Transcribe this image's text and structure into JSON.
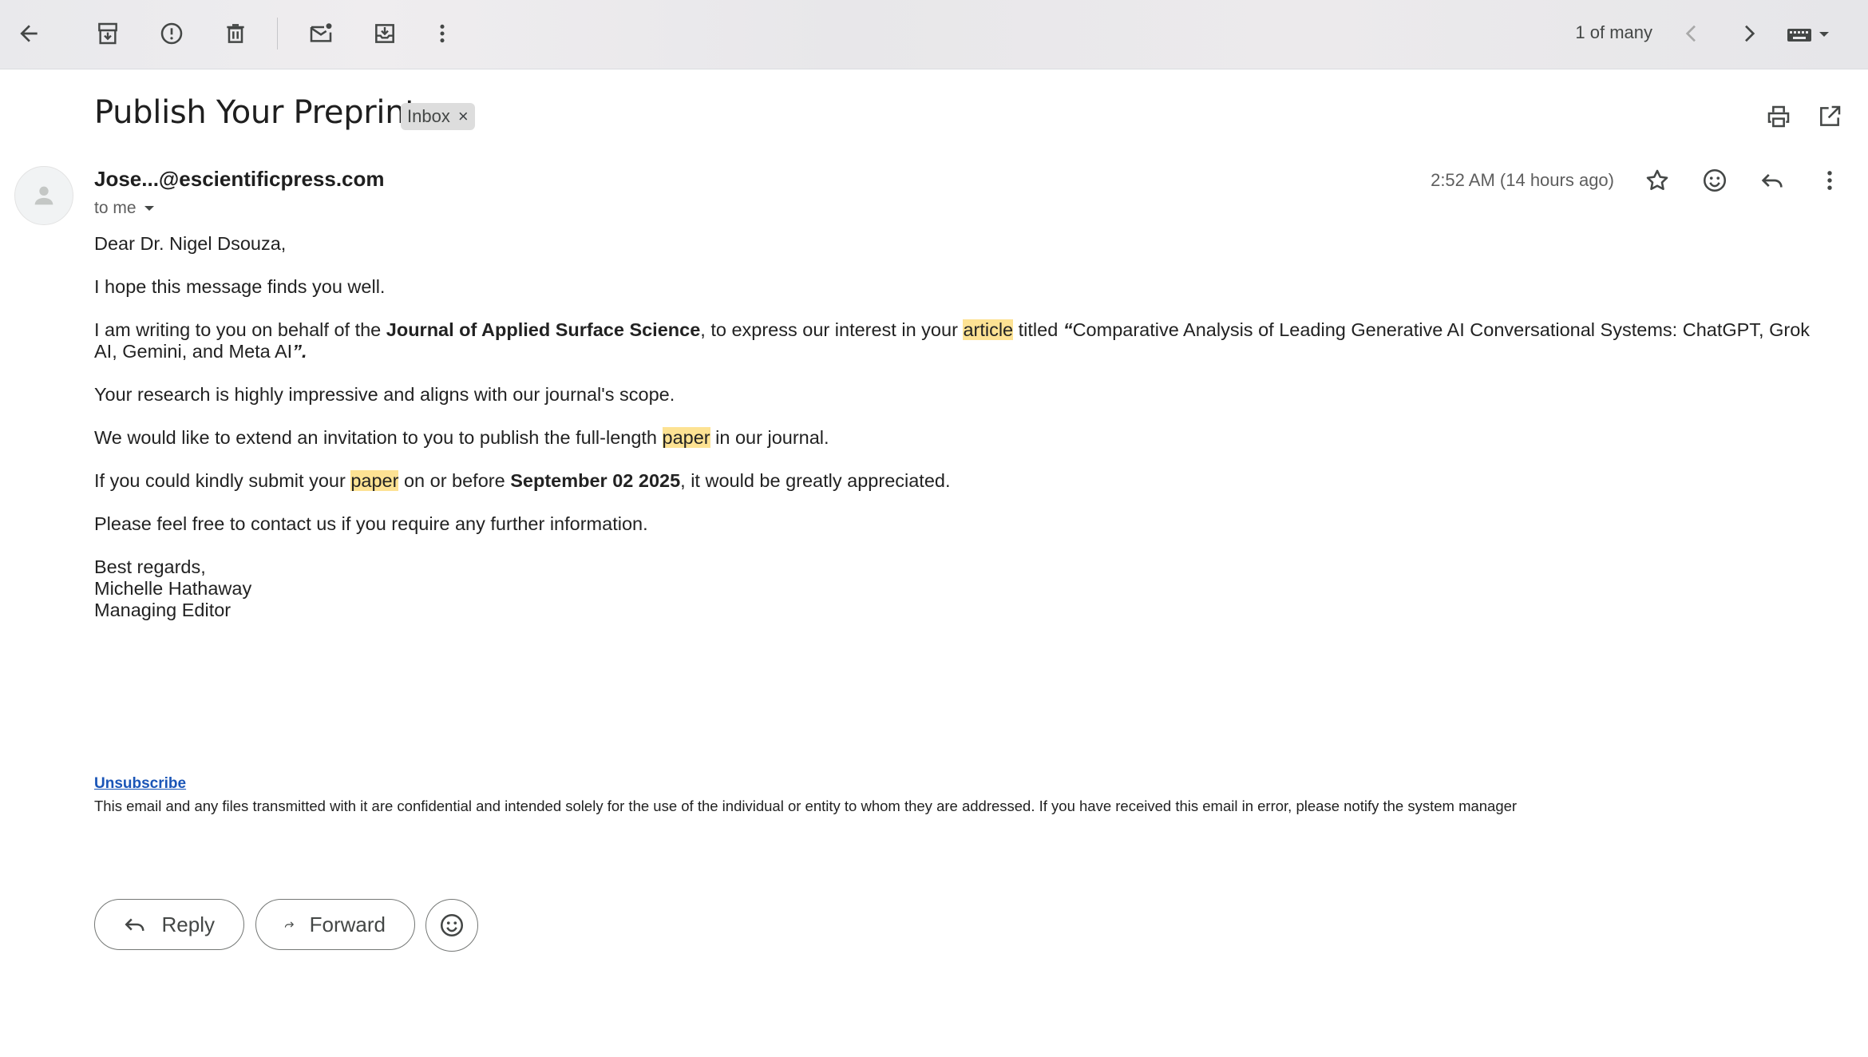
{
  "toolbar": {
    "icons": [
      "back-arrow-icon",
      "archive-icon",
      "report-spam-icon",
      "delete-icon",
      "mark-unread-icon",
      "move-to-icon",
      "more-vert-icon"
    ],
    "pager_text": "1 of many",
    "nav_icons": [
      "chevron-left-icon",
      "chevron-right-icon",
      "keyboard-icon"
    ]
  },
  "header": {
    "subject": "Publish Your Preprint",
    "label": "Inbox",
    "label_remove": "×",
    "right_icons": [
      "print-icon",
      "open-in-new-window-icon"
    ]
  },
  "message": {
    "sender": "Jose...@escientificpress.com",
    "recipient": "to me",
    "timestamp": "2:52 AM (14 hours ago)",
    "action_icons": [
      "star-icon",
      "emoji-reaction-icon",
      "reply-icon",
      "more-vert-icon"
    ]
  },
  "body": {
    "greeting": "Dear Dr. Nigel Dsouza,",
    "p1": "I hope this message finds you well.",
    "p2": {
      "a": "I am writing to you on behalf of the ",
      "journal": "Journal of Applied Surface Science",
      "b": ", to express our interest in your ",
      "hl_article": "article",
      "c": " titled ",
      "open_quote": "“",
      "title": "Comparative Analysis of Leading Generative AI Conversational Systems: ChatGPT, Grok AI, Gemini, and Meta AI",
      "close_quote": "”."
    },
    "p3": "Your research is highly impressive and aligns with our journal's scope.",
    "p4": {
      "a": "We would like to extend an invitation to you to publish the full-length ",
      "hl_paper": "paper",
      "b": " in our journal."
    },
    "p5": {
      "a": "If you could kindly submit your ",
      "hl_paper": "paper",
      "b": " on or before ",
      "deadline": "September 02 2025",
      "c": ", it would be greatly appreciated."
    },
    "p6": "Please feel free to contact us if you require any further information.",
    "signature": {
      "closing": "Best regards,",
      "name": "Michelle Hathaway",
      "role": "Managing Editor"
    },
    "unsubscribe": "Unsubscribe",
    "disclaimer": "This email and any files transmitted with it are confidential and intended solely for the use of the individual or entity to whom they are addressed. If you have received this email in error, please notify the system manager"
  },
  "actions": {
    "reply": "Reply",
    "forward": "Forward"
  },
  "colors": {
    "highlight": "#fde293",
    "link": "#1a55b7",
    "icon": "#444746"
  }
}
